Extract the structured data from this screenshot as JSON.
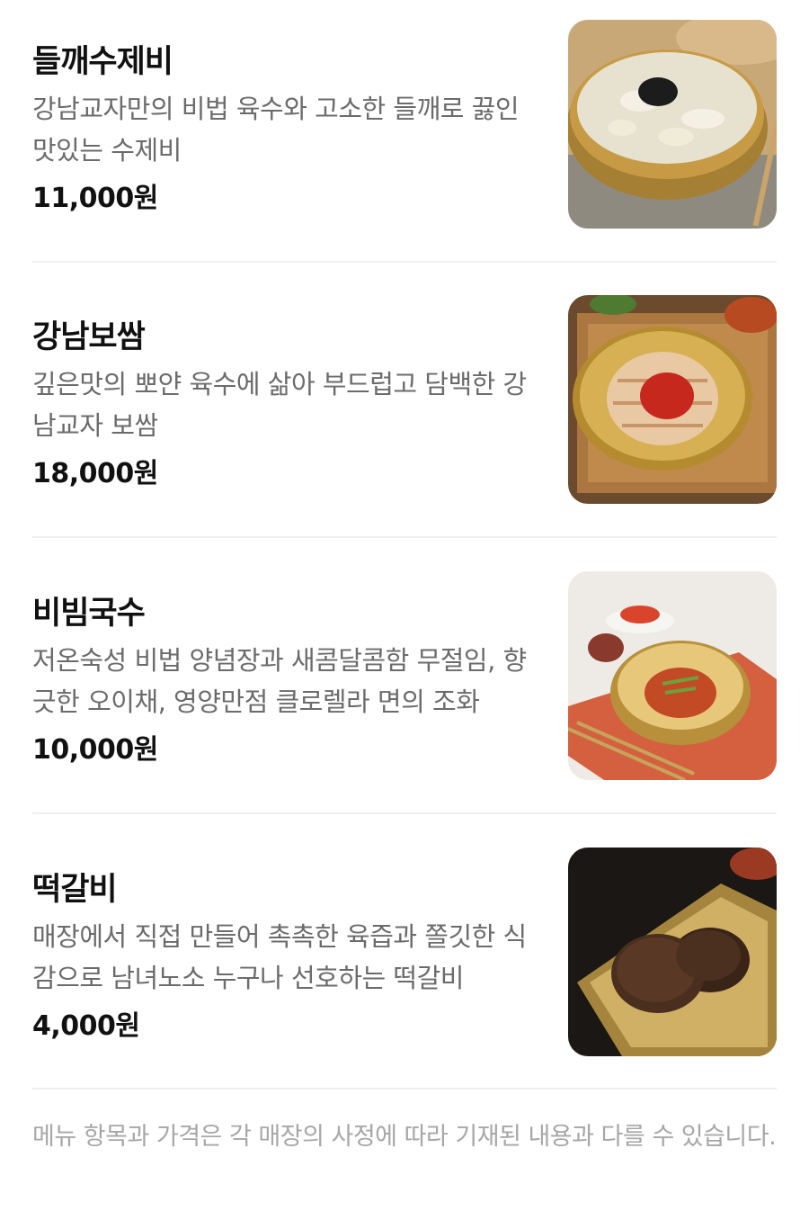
{
  "menu": {
    "items": [
      {
        "name": "들깨수제비",
        "description": "강남교자만의 비법 육수와 고소한 들깨로 끓인 맛있는 수제비",
        "price": "11,000원",
        "image_icon": "perilla-sujebi-photo"
      },
      {
        "name": "강남보쌈",
        "description": "깊은맛의 뽀얀 육수에 삶아 부드럽고 담백한 강남교자 보쌈",
        "price": "18,000원",
        "image_icon": "bossam-photo"
      },
      {
        "name": "비빔국수",
        "description": "저온숙성 비법 양념장과 새콤달콤함 무절임, 향긋한 오이채, 영양만점 클로렐라 면의 조화",
        "price": "10,000원",
        "image_icon": "bibim-guksu-photo"
      },
      {
        "name": "떡갈비",
        "description": "매장에서 직접 만들어 촉촉한 육즙과 쫄깃한 식감으로 남녀노소 누구나 선호하는 떡갈비",
        "price": "4,000원",
        "image_icon": "tteokgalbi-photo"
      }
    ]
  },
  "notice": "메뉴 항목과 가격은 각 매장의 사정에 따라 기재된 내용과 다를 수 있습니다.",
  "colors": {
    "text_primary": "#111111",
    "text_secondary": "#6b6b6b",
    "text_notice": "#a7a7a7",
    "divider": "#f0f0f0"
  }
}
